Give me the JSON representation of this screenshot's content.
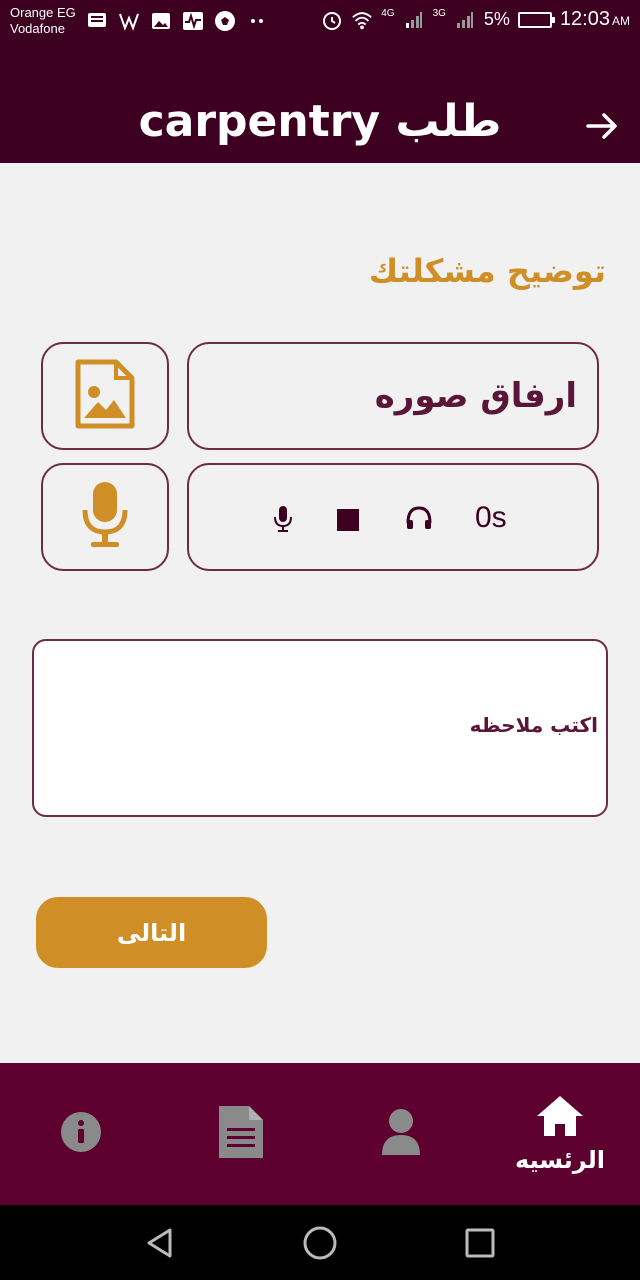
{
  "status_bar": {
    "carrier_line1": "Orange EG",
    "carrier_line2": "Vodafone",
    "network1": "4G",
    "network2": "3G",
    "battery": "5%",
    "time": "12:03",
    "ampm": "AM"
  },
  "app_bar": {
    "title": "طلب carpentry",
    "back_icon": "arrow-right-icon"
  },
  "main": {
    "section_title": "توضيح مشكلتك",
    "attach_image_label": "ارفاق صوره",
    "recorder_time": "0s",
    "note_placeholder": "اكتب ملاحظه",
    "next_button": "التالى"
  },
  "bottom_nav": {
    "items": [
      {
        "icon": "info-icon",
        "label": ""
      },
      {
        "icon": "document-icon",
        "label": ""
      },
      {
        "icon": "user-icon",
        "label": ""
      },
      {
        "icon": "home-icon",
        "label": "الرئسيه"
      }
    ]
  },
  "colors": {
    "primary_dark": "#3d0020",
    "nav_bg": "#5d0030",
    "accent": "#d08e26",
    "border": "#6d2b48"
  }
}
